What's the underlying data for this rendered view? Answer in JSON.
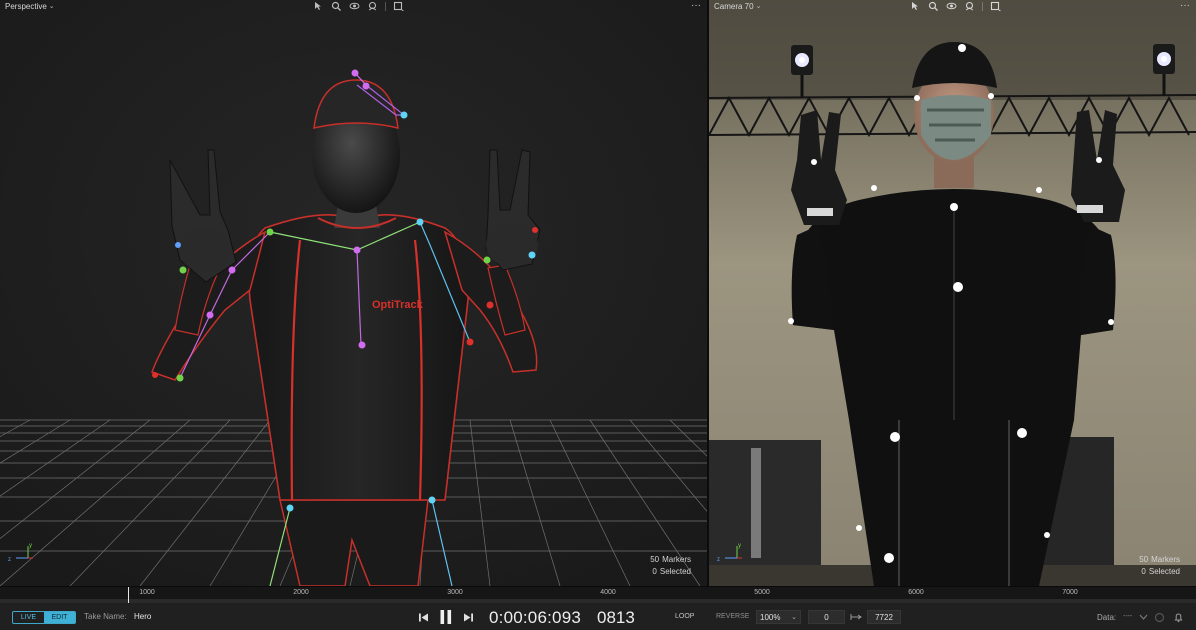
{
  "left_viewport": {
    "title": "Perspective",
    "suit_logo": "OptiTrack",
    "markers_count": "50",
    "markers_label": "Markers",
    "selected_count": "0",
    "selected_label": "Selected"
  },
  "right_viewport": {
    "title": "Camera 70",
    "markers_count": "50",
    "markers_label": "Markers",
    "selected_count": "0",
    "selected_label": "Selected"
  },
  "timeline": {
    "ticks": [
      "1000",
      "2000",
      "3000",
      "4000",
      "5000",
      "6000",
      "7000"
    ]
  },
  "toolbar": {
    "live_label": "LIVE",
    "edit_label": "EDIT",
    "take_name_label": "Take Name:",
    "take_name_value": "Hero",
    "timecode": "0:00:06:093",
    "frame": "0813",
    "loop_label": "LOOP",
    "reverse_label": "REVERSE",
    "speed": "100%",
    "range_start": "0",
    "range_end": "7722",
    "data_label": "Data:",
    "data_value": "----"
  },
  "colors": {
    "accent": "#3fb0d6",
    "marker_magenta": "#d36cf0",
    "marker_cyan": "#5fd4f5",
    "marker_green": "#6fd24a",
    "marker_red": "#e0302c",
    "suit_red": "#d8302a"
  }
}
